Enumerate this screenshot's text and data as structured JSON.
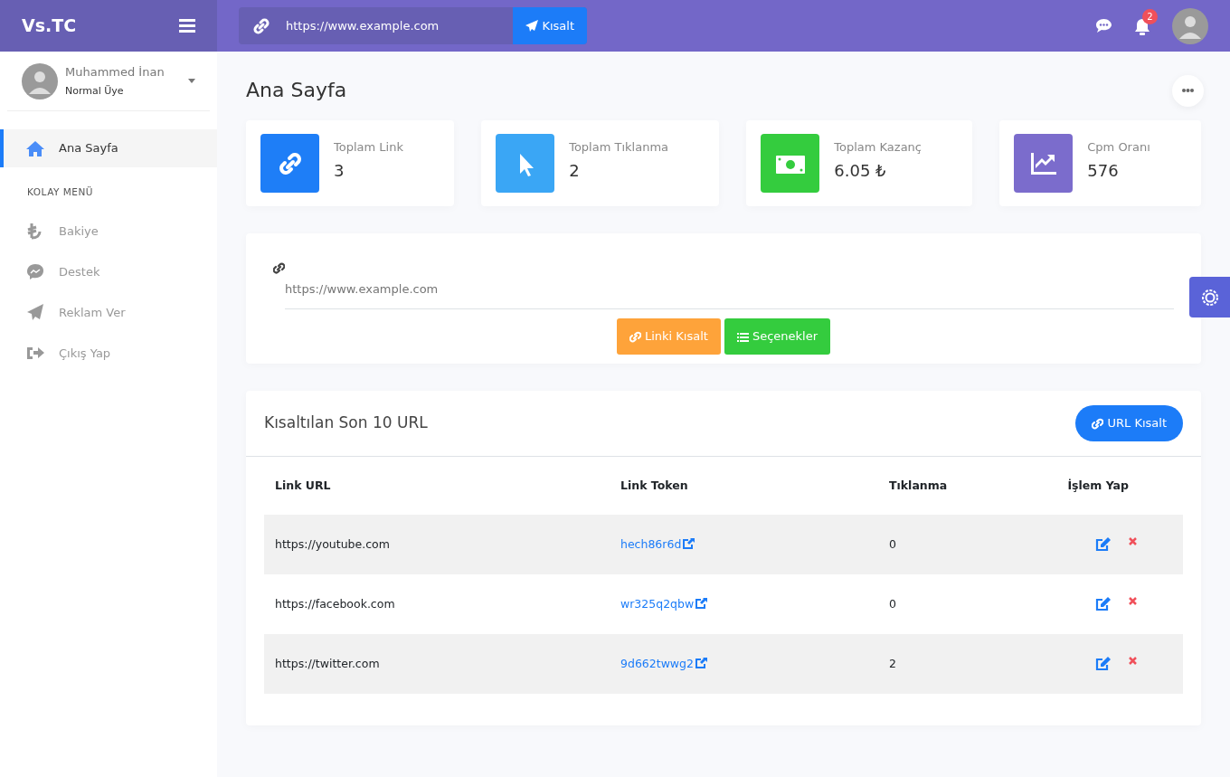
{
  "brand": "Vs.TC",
  "topbar": {
    "url_field": {
      "placeholder": "https://www.example.com"
    },
    "shorten_button": "Kısalt",
    "notifications": "2"
  },
  "user": {
    "name": "Muhammed İnan",
    "role": "Normal Üye"
  },
  "sidebar": {
    "items": [
      {
        "label": "Ana Sayfa",
        "selected": true
      }
    ],
    "section": "KOLAY MENÜ",
    "menu": [
      {
        "label": "Bakiye",
        "selected": false
      },
      {
        "label": "Destek",
        "selected": false
      },
      {
        "label": "Reklam Ver",
        "selected": false
      },
      {
        "label": "Çıkış Yap",
        "selected": false
      }
    ]
  },
  "page_title": "Ana Sayfa",
  "stats": [
    {
      "label": "Toplam Link",
      "value": "3",
      "color": "#1e7ef7"
    },
    {
      "label": "Toplam Tıklanma",
      "value": "2",
      "color": "#3aa6f5"
    },
    {
      "label": "Toplam Kazanç",
      "value": "6.05 ₺",
      "color": "#34cc3e"
    },
    {
      "label": "Cpm Oranı",
      "value": "576",
      "color": "#7b6ccc"
    }
  ],
  "shortener": {
    "placeholder": "https://www.example.com",
    "buttons": [
      "Linki Kısalt",
      "Seçenekler"
    ]
  },
  "recent": {
    "title": "Kısaltılan Son 10 URL",
    "button": "URL Kısalt",
    "columns": [
      "Link URL",
      "Link Token",
      "Tıklanma",
      "İşlem Yap"
    ],
    "rows": [
      {
        "url": "https://youtube.com",
        "token": "hech86r6d",
        "clicks": "0"
      },
      {
        "url": "https://facebook.com",
        "token": "wr325q2qbw",
        "clicks": "0"
      },
      {
        "url": "https://twitter.com",
        "token": "9d662twwg2",
        "clicks": "2"
      }
    ]
  }
}
